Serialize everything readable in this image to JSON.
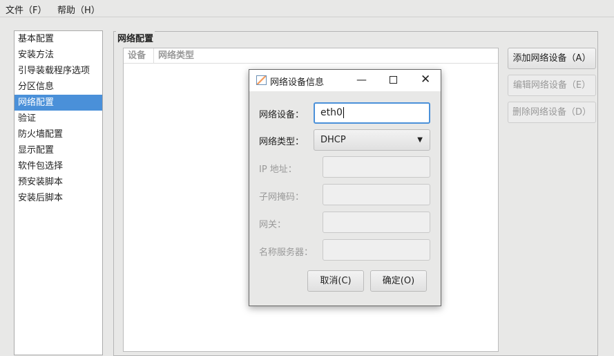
{
  "menu": {
    "file": "文件（F）",
    "help": "帮助（H）"
  },
  "sidebar": {
    "items": [
      "基本配置",
      "安装方法",
      "引导装载程序选项",
      "分区信息",
      "网络配置",
      "验证",
      "防火墙配置",
      "显示配置",
      "软件包选择",
      "预安装脚本",
      "安装后脚本"
    ],
    "selected": 4
  },
  "section": {
    "title": "网络配置",
    "columns": [
      "设备",
      "网络类型"
    ]
  },
  "actions": {
    "add": "添加网络设备（A）",
    "edit": "编辑网络设备（E）",
    "delete": "删除网络设备（D）"
  },
  "dialog": {
    "title": "网络设备信息",
    "device_label": "网络设备：",
    "device_value": "eth0",
    "type_label": "网络类型：",
    "type_value": "DHCP",
    "ip_label": "IP 地址：",
    "mask_label": "子网掩码：",
    "gateway_label": "网关：",
    "dns_label": "名称服务器：",
    "cancel": "取消(C)",
    "ok": "确定(O)"
  }
}
